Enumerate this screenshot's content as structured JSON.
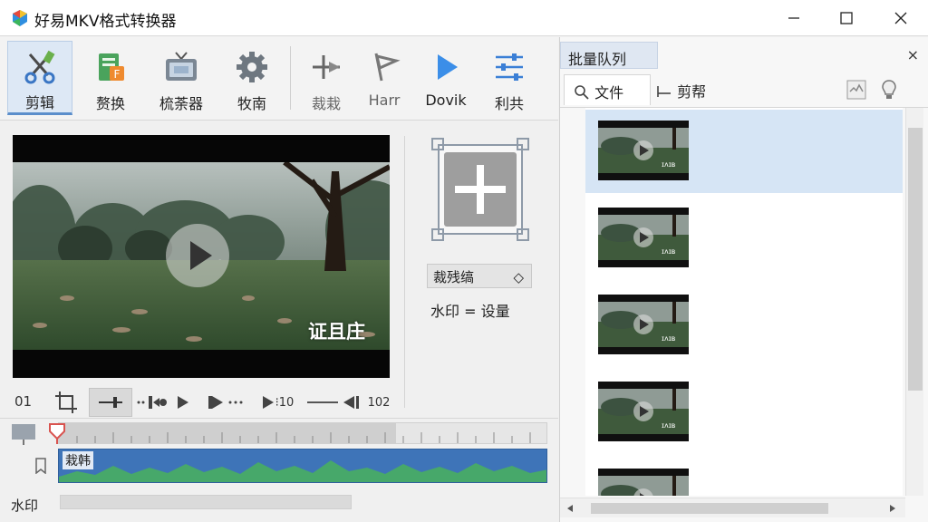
{
  "app": {
    "title": "好易MKV格式转换器"
  },
  "window": {
    "minimize": "—",
    "maximize": "☐",
    "close": "✕"
  },
  "toolbar": {
    "items": [
      {
        "label": "剪辑",
        "icon": "scissors-icon",
        "active": true
      },
      {
        "label": "赘换",
        "icon": "convert-icon"
      },
      {
        "label": "梳荼器",
        "icon": "tv-icon"
      },
      {
        "label": "牧南",
        "icon": "gear-icon"
      },
      {
        "label": "裁栽",
        "icon": "crop-icon"
      },
      {
        "label": "Harr",
        "icon": "flag-icon"
      },
      {
        "label": "Dovik",
        "icon": "play-icon"
      },
      {
        "label": "利共",
        "icon": "sliders-icon"
      }
    ]
  },
  "preview": {
    "watermark_text": "证且庄"
  },
  "side": {
    "crop_label": "裁残缟",
    "crop_arrow": "◇",
    "watermark_setting": "水印 = 设量"
  },
  "controls": {
    "time_start": "01",
    "step_label": "⁝10",
    "time_end": "102"
  },
  "timeline": {
    "clip_label": "栽韩",
    "watermark_track": "水印"
  },
  "batch": {
    "tab": "批量队列",
    "close": "×",
    "file_tab": "文件",
    "clip_tab": "剪帮",
    "thumb_caption": "ɪʌɪʙ",
    "items": [
      {
        "selected": true
      },
      {},
      {},
      {},
      {}
    ]
  },
  "colors": {
    "accent": "#5b8ecb",
    "track": "#3e74b8",
    "wave": "#47a86a",
    "selected": "#d6e5f5"
  }
}
